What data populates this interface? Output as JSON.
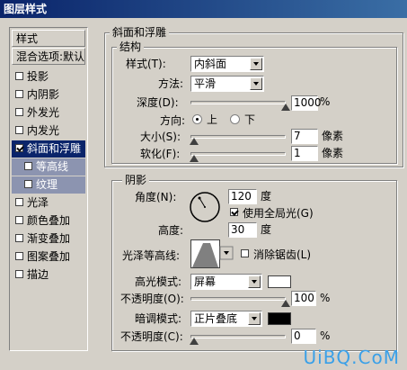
{
  "window": {
    "title": "图层样式"
  },
  "left_panel": {
    "header": "样式",
    "blend": "混合选项:默认",
    "items": [
      {
        "label": "投影",
        "checked": false
      },
      {
        "label": "内阴影",
        "checked": false
      },
      {
        "label": "外发光",
        "checked": false
      },
      {
        "label": "内发光",
        "checked": false
      },
      {
        "label": "斜面和浮雕",
        "checked": true
      },
      {
        "label": "等高线",
        "checked": false
      },
      {
        "label": "纹理",
        "checked": false
      },
      {
        "label": "光泽",
        "checked": false
      },
      {
        "label": "颜色叠加",
        "checked": false
      },
      {
        "label": "渐变叠加",
        "checked": false
      },
      {
        "label": "图案叠加",
        "checked": false
      },
      {
        "label": "描边",
        "checked": false
      }
    ]
  },
  "bevel": {
    "title": "斜面和浮雕",
    "structure_title": "结构",
    "style_label": "样式(T):",
    "style_value": "内斜面",
    "method_label": "方法:",
    "method_value": "平滑",
    "depth_label": "深度(D):",
    "depth_value": "1000",
    "depth_unit": "%",
    "direction_label": "方向:",
    "dir_up": "上",
    "dir_down": "下",
    "size_label": "大小(S):",
    "size_value": "7",
    "size_unit": "像素",
    "soften_label": "软化(F):",
    "soften_value": "1",
    "soften_unit": "像素"
  },
  "shading": {
    "title": "阴影",
    "angle_label": "角度(N):",
    "angle_value": "120",
    "angle_unit": "度",
    "global_light_label": "使用全局光(G)",
    "altitude_label": "高度:",
    "altitude_value": "30",
    "altitude_unit": "度",
    "gloss_label": "光泽等高线:",
    "antialias_label": "消除锯齿(L)",
    "highlight_mode_label": "高光模式:",
    "highlight_mode_value": "屏幕",
    "highlight_opacity_label": "不透明度(O):",
    "highlight_opacity_value": "100",
    "shadow_mode_label": "暗调模式:",
    "shadow_mode_value": "正片叠底",
    "shadow_opacity_label": "不透明度(C):",
    "shadow_opacity_value": "0",
    "percent": "%",
    "highlight_color": "#ffffff",
    "shadow_color": "#000000"
  },
  "watermark": "UiBQ.CoM"
}
